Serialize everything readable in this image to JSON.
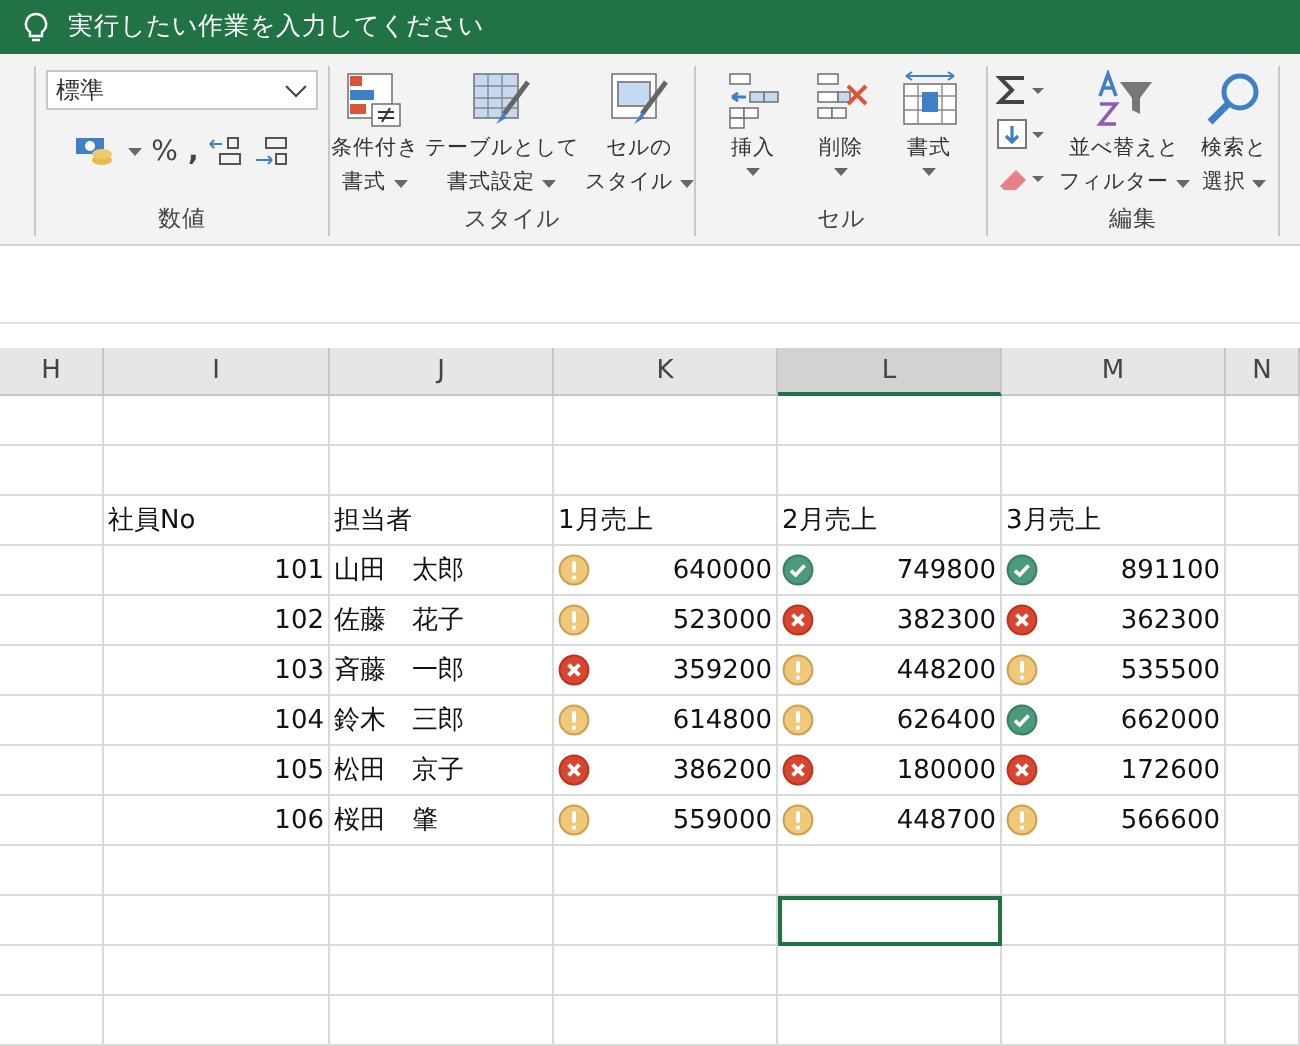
{
  "title_bar": {
    "search_hint": "実行したい作業を入力してください"
  },
  "ribbon": {
    "number_group": {
      "format": "標準",
      "percent": "%",
      "comma": ",",
      "label": "数値"
    },
    "style_group": {
      "label": "スタイル",
      "buttons": [
        {
          "kind": "conditional",
          "lines": [
            "条件付き",
            "書式"
          ]
        },
        {
          "kind": "table",
          "lines": [
            "テーブルとして",
            "書式設定"
          ]
        },
        {
          "kind": "cellstyle",
          "lines": [
            "セルの",
            "スタイル"
          ]
        }
      ]
    },
    "cells_group": {
      "label": "セル",
      "buttons": [
        {
          "kind": "insert",
          "label": "挿入"
        },
        {
          "kind": "delete",
          "label": "削除"
        },
        {
          "kind": "format",
          "label": "書式"
        }
      ]
    },
    "edit_group": {
      "label": "編集",
      "buttons": [
        {
          "kind": "sort",
          "lines": [
            "並べ替えと",
            "フィルター"
          ]
        },
        {
          "kind": "find",
          "lines": [
            "検索と",
            "選択"
          ]
        }
      ]
    }
  },
  "sheet": {
    "columns": [
      {
        "label": "H",
        "selected": false
      },
      {
        "label": "I",
        "selected": false
      },
      {
        "label": "J",
        "selected": false
      },
      {
        "label": "K",
        "selected": false
      },
      {
        "label": "L",
        "selected": true
      },
      {
        "label": "M",
        "selected": false
      },
      {
        "label": "N",
        "selected": false
      }
    ],
    "rows": [
      {
        "kind": "blank",
        "active": false
      },
      {
        "kind": "blank",
        "active": false
      },
      {
        "kind": "header",
        "cells": [
          "社員No",
          "担当者",
          "1月売上",
          "2月売上",
          "3月売上"
        ]
      },
      {
        "kind": "data",
        "no": "101",
        "name": "山田　太郎",
        "sales": [
          {
            "kind": "warning",
            "value": "640000"
          },
          {
            "kind": "good",
            "value": "749800"
          },
          {
            "kind": "good",
            "value": "891100"
          }
        ]
      },
      {
        "kind": "data",
        "no": "102",
        "name": "佐藤　花子",
        "sales": [
          {
            "kind": "warning",
            "value": "523000"
          },
          {
            "kind": "bad",
            "value": "382300"
          },
          {
            "kind": "bad",
            "value": "362300"
          }
        ]
      },
      {
        "kind": "data",
        "no": "103",
        "name": "斉藤　一郎",
        "sales": [
          {
            "kind": "bad",
            "value": "359200"
          },
          {
            "kind": "warning",
            "value": "448200"
          },
          {
            "kind": "warning",
            "value": "535500"
          }
        ]
      },
      {
        "kind": "data",
        "no": "104",
        "name": "鈴木　三郎",
        "sales": [
          {
            "kind": "warning",
            "value": "614800"
          },
          {
            "kind": "warning",
            "value": "626400"
          },
          {
            "kind": "good",
            "value": "662000"
          }
        ]
      },
      {
        "kind": "data",
        "no": "105",
        "name": "松田　京子",
        "sales": [
          {
            "kind": "bad",
            "value": "386200"
          },
          {
            "kind": "bad",
            "value": "180000"
          },
          {
            "kind": "bad",
            "value": "172600"
          }
        ]
      },
      {
        "kind": "data",
        "no": "106",
        "name": "桜田　肇",
        "sales": [
          {
            "kind": "warning",
            "value": "559000"
          },
          {
            "kind": "warning",
            "value": "448700"
          },
          {
            "kind": "warning",
            "value": "566600"
          }
        ]
      },
      {
        "kind": "blank",
        "active": false
      },
      {
        "kind": "blank",
        "active": true
      },
      {
        "kind": "blank",
        "active": false
      },
      {
        "kind": "blank",
        "active": false
      }
    ]
  }
}
